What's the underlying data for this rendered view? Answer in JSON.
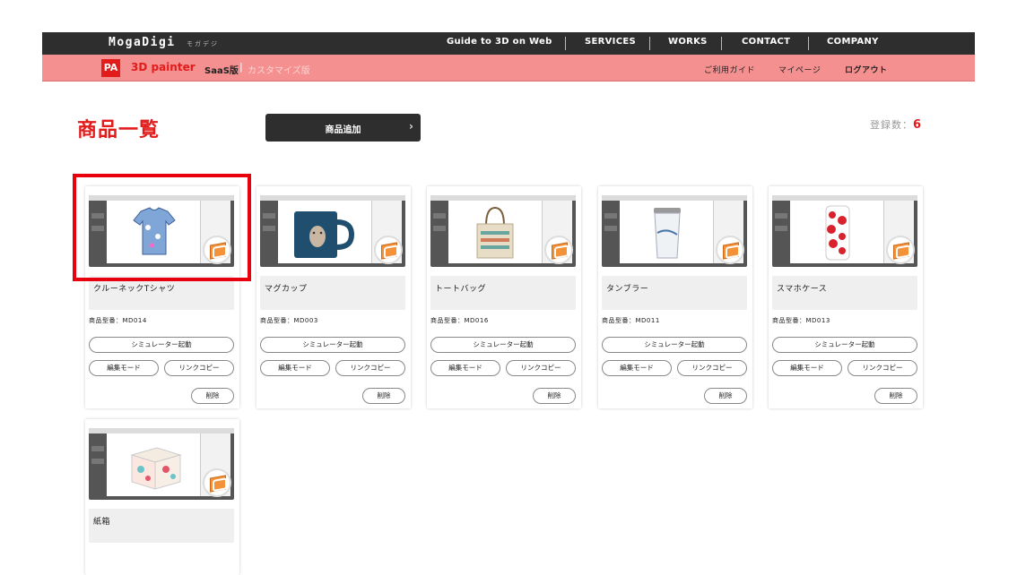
{
  "header": {
    "logo": "MogaDigi",
    "logo_kana": "モガデジ",
    "nav": [
      "Guide to 3D on Web",
      "SERVICES",
      "WORKS",
      "CONTACT",
      "COMPANY"
    ]
  },
  "subheader": {
    "badge": "PA",
    "app_name": "3D painter",
    "saas": "SaaS版",
    "divider": "|",
    "custom": "カスタマイズ版",
    "nav": [
      "ご利用ガイド",
      "マイページ",
      "ログアウト"
    ]
  },
  "page": {
    "title": "商品一覧",
    "add_button": "商品追加",
    "add_chevron": "›",
    "count_label": "登録数：",
    "count_value": "6"
  },
  "buttons": {
    "simulator": "シミュレーター起動",
    "edit": "編集モード",
    "copy": "リンクコピー",
    "delete": "削除"
  },
  "products": [
    {
      "name": "クルーネックTシャツ",
      "model": "商品型番：MD014",
      "icon": "tshirt"
    },
    {
      "name": "マグカップ",
      "model": "商品型番：MD003",
      "icon": "mug"
    },
    {
      "name": "トートバッグ",
      "model": "商品型番：MD016",
      "icon": "tote-bag"
    },
    {
      "name": "タンブラー",
      "model": "商品型番：MD011",
      "icon": "tumbler"
    },
    {
      "name": "スマホケース",
      "model": "商品型番：MD013",
      "icon": "phone-case"
    },
    {
      "name": "紙箱",
      "model": "",
      "icon": "paper-box"
    }
  ],
  "colors": {
    "brand_red": "#e21b1b",
    "pink_bar": "#f59090",
    "dark_bar": "#2e2e2e",
    "highlight": "#e8000d"
  }
}
